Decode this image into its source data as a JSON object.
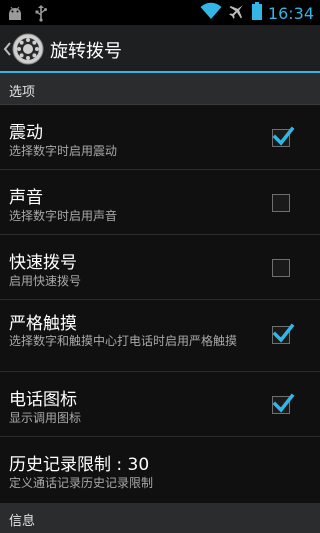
{
  "status_bar": {
    "time": "16:34",
    "left_icons": [
      "android-notification-icon",
      "usb-icon"
    ],
    "right_icons": [
      "wifi-icon",
      "airplane-icon",
      "battery-icon"
    ]
  },
  "action_bar": {
    "title": "旋转拨号",
    "app_icon": "rotary-dial-icon"
  },
  "sections": {
    "options_header": "选项",
    "info_header": "信息"
  },
  "preferences": [
    {
      "title": "震动",
      "summary": "选择数字时启用震动",
      "checked": true
    },
    {
      "title": "声音",
      "summary": "选择数字时启用声音",
      "checked": false
    },
    {
      "title": "快速拨号",
      "summary": "启用快速拨号",
      "checked": false
    },
    {
      "title": "严格触摸",
      "summary": "选择数字和触摸中心打电话时启用严格触摸",
      "checked": true
    },
    {
      "title": "电话图标",
      "summary": "显示调用图标",
      "checked": true
    },
    {
      "title": "历史记录限制 : 30",
      "summary": "定义通话记录历史记录限制"
    }
  ],
  "colors": {
    "accent": "#33b5e5",
    "background": "#101010",
    "category_bg": "#2b2c2e"
  }
}
